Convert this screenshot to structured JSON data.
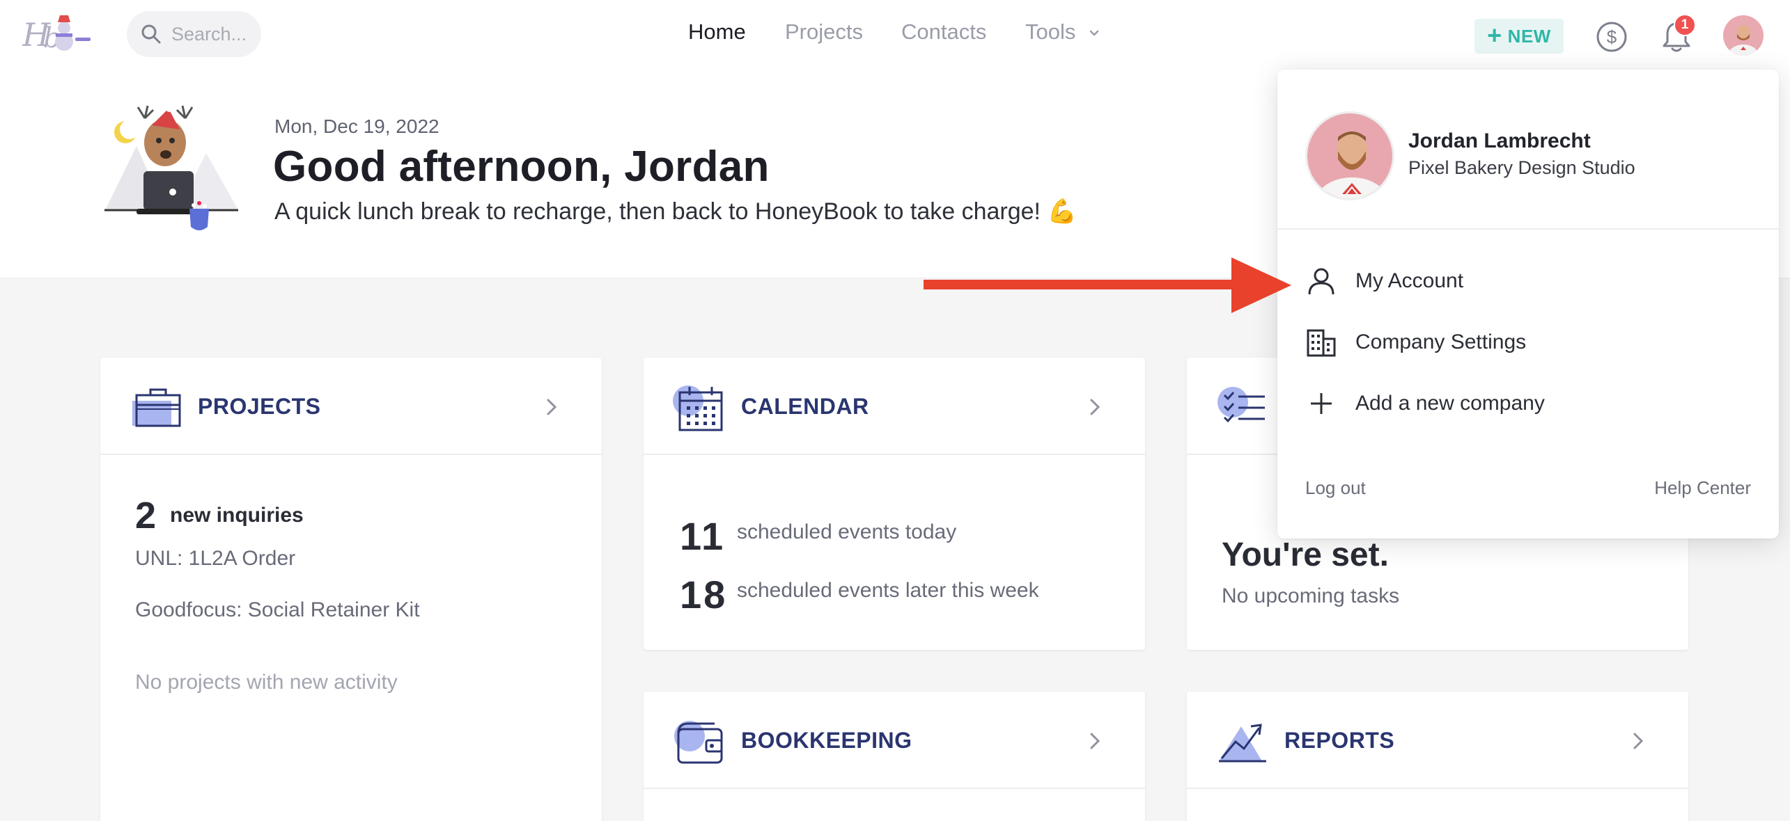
{
  "topbar": {
    "search_placeholder": "Search...",
    "nav": [
      {
        "label": "Home",
        "active": true
      },
      {
        "label": "Projects",
        "active": false
      },
      {
        "label": "Contacts",
        "active": false
      },
      {
        "label": "Tools",
        "active": false
      }
    ],
    "new_label": "NEW",
    "notification_count": "1"
  },
  "greeting": {
    "date": "Mon, Dec 19, 2022",
    "headline": "Good afternoon, Jordan",
    "tagline": "A quick lunch break to recharge, then back to HoneyBook to take charge! 💪"
  },
  "cards": {
    "projects": {
      "title": "PROJECTS",
      "count": "2",
      "count_label": "new inquiries",
      "items": [
        "UNL: 1L2A Order",
        "Goodfocus: Social Retainer Kit"
      ],
      "empty": "No projects with new activity"
    },
    "calendar": {
      "title": "CALENDAR",
      "today_count": "11",
      "today_label": "scheduled events today",
      "week_count": "18",
      "week_label": "scheduled events later this week"
    },
    "tasks": {
      "status": "You're set.",
      "sub": "No upcoming tasks"
    },
    "bookkeeping": {
      "title": "BOOKKEEPING"
    },
    "reports": {
      "title": "REPORTS"
    }
  },
  "dropdown": {
    "name": "Jordan Lambrecht",
    "company": "Pixel Bakery Design Studio",
    "items": [
      "My Account",
      "Company Settings",
      "Add a new company"
    ],
    "logout": "Log out",
    "help": "Help Center"
  },
  "colors": {
    "accent_teal": "#2fb6a8",
    "card_title": "#2a3570",
    "icon_lavender": "#a9b5ee",
    "badge_red": "#f05151",
    "arrow_red": "#e8412c"
  }
}
